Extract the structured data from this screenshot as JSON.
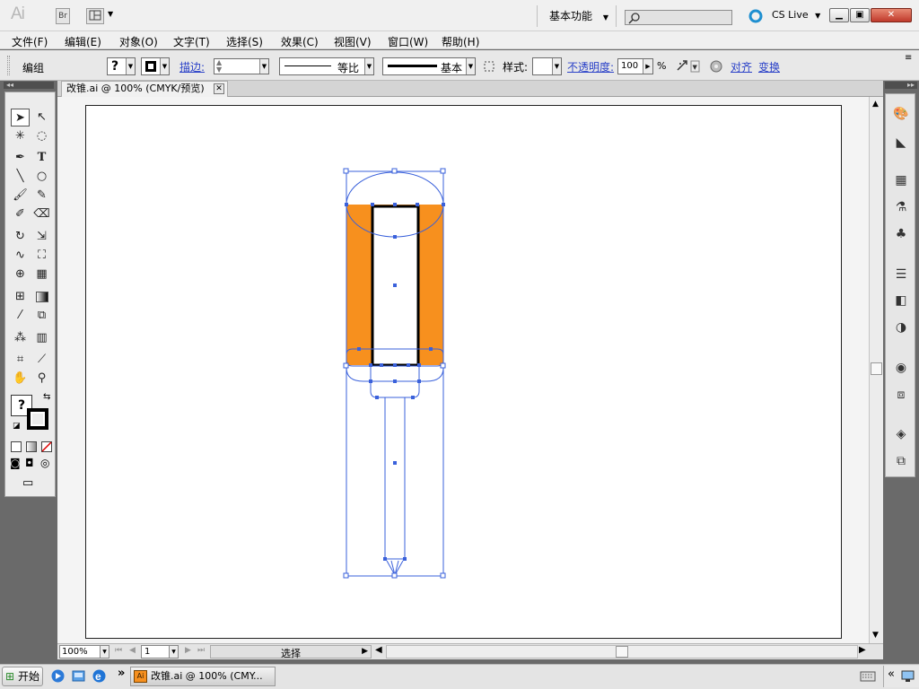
{
  "app": {
    "logo": "Ai",
    "bridge_label": "Br"
  },
  "workspace": {
    "label": "基本功能",
    "search_placeholder": ""
  },
  "cslive": {
    "label": "CS Live"
  },
  "menu": [
    "文件(F)",
    "编辑(E)",
    "对象(O)",
    "文字(T)",
    "选择(S)",
    "效果(C)",
    "视图(V)",
    "窗口(W)",
    "帮助(H)"
  ],
  "control": {
    "mode_label": "编组",
    "fill_value": "?",
    "stroke_label": "描边:",
    "stroke_weight": "",
    "profile_label": "等比",
    "brush_label": "基本",
    "style_label": "样式:",
    "opacity_label": "不透明度:",
    "opacity_value": "100",
    "percent": "%",
    "align_label": "对齐",
    "transform_label": "变换"
  },
  "document": {
    "tab_title": "改锥.ai @ 100% (CMYK/预览)"
  },
  "status": {
    "zoom": "100%",
    "page": "1",
    "tool_label": "选择"
  },
  "taskbar": {
    "start": "开始",
    "item": "改锥.ai @ 100% (CMY...",
    "item_icon": "Ai",
    "more": "»"
  },
  "tools_fill_value": "?",
  "colors": {
    "handle_fill": "#f7901e",
    "selection_blue": "#3a61db",
    "ui_gray": "#6a6a6a"
  }
}
